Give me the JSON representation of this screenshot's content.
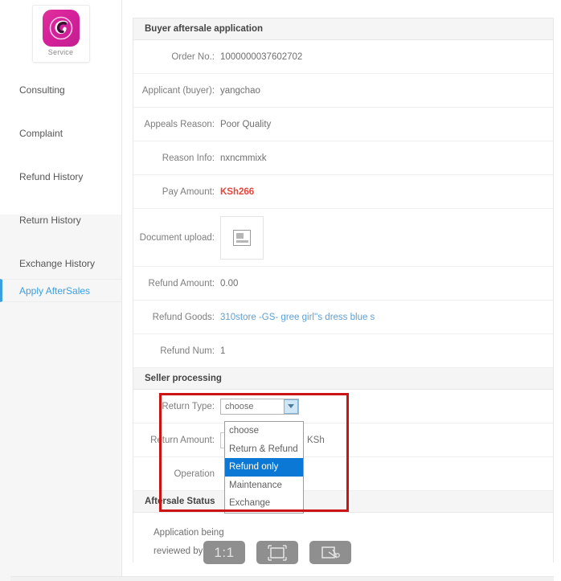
{
  "sidebar": {
    "logo": {
      "caption": "Service",
      "icon": "service-swirl-logo",
      "color": "#d6219b"
    },
    "items": [
      {
        "label": "Consulting",
        "active": false
      },
      {
        "label": "Complaint",
        "active": false
      },
      {
        "label": "Refund History",
        "active": false
      },
      {
        "label": "Return History",
        "active": false
      },
      {
        "label": "Exchange History",
        "active": false
      },
      {
        "label": "Apply AfterSales",
        "active": true
      }
    ],
    "active_color": "#3b9fe0"
  },
  "main": {
    "sections": {
      "buyer": {
        "title": "Buyer aftersale application"
      },
      "seller": {
        "title": "Seller processing"
      },
      "status": {
        "title": "Aftersale Status"
      }
    },
    "buyer_fields": [
      {
        "label": "Order No.:",
        "value": "1000000037602702",
        "style": "plain"
      },
      {
        "label": "Applicant (buyer):",
        "value": "yangchao",
        "style": "plain"
      },
      {
        "label": "Appeals Reason:",
        "value": "Poor Quality",
        "style": "plain"
      },
      {
        "label": "Reason Info:",
        "value": "nxncmmixk",
        "style": "plain"
      },
      {
        "label": "Pay Amount:",
        "value": "KSh266",
        "style": "price"
      }
    ],
    "upload": {
      "label": "Document upload:",
      "icon": "broken-image-icon"
    },
    "buyer_fields_2": [
      {
        "label": "Refund Amount:",
        "value": "0.00",
        "style": "plain"
      },
      {
        "label": "Refund Goods:",
        "value": "310store -GS- gree girl''s dress blue s",
        "style": "link"
      },
      {
        "label": "Refund Num:",
        "value": "1",
        "style": "plain"
      }
    ],
    "seller_fields": {
      "return_type_label": "Return Type:",
      "return_type_value": "choose",
      "return_amount_label": "Return Amount:",
      "return_amount_value": "",
      "currency_suffix": "KSh",
      "operation_label": "Operation"
    },
    "dropdown": {
      "options": [
        "choose",
        "Return & Refund",
        "Refund only",
        "Maintenance",
        "Exchange"
      ],
      "selected": "Refund only",
      "highlight_color": "#0a78d4"
    },
    "status": {
      "line1": "Application being",
      "line2": "reviewed by seller"
    }
  },
  "overlay": {
    "annotation_color": "#cc1414",
    "toolbar": [
      {
        "name": "ratio-1-1-button",
        "label": "1:1"
      },
      {
        "name": "crop-frame-button",
        "label": ""
      },
      {
        "name": "screenshot-cut-button",
        "label": ""
      }
    ]
  }
}
